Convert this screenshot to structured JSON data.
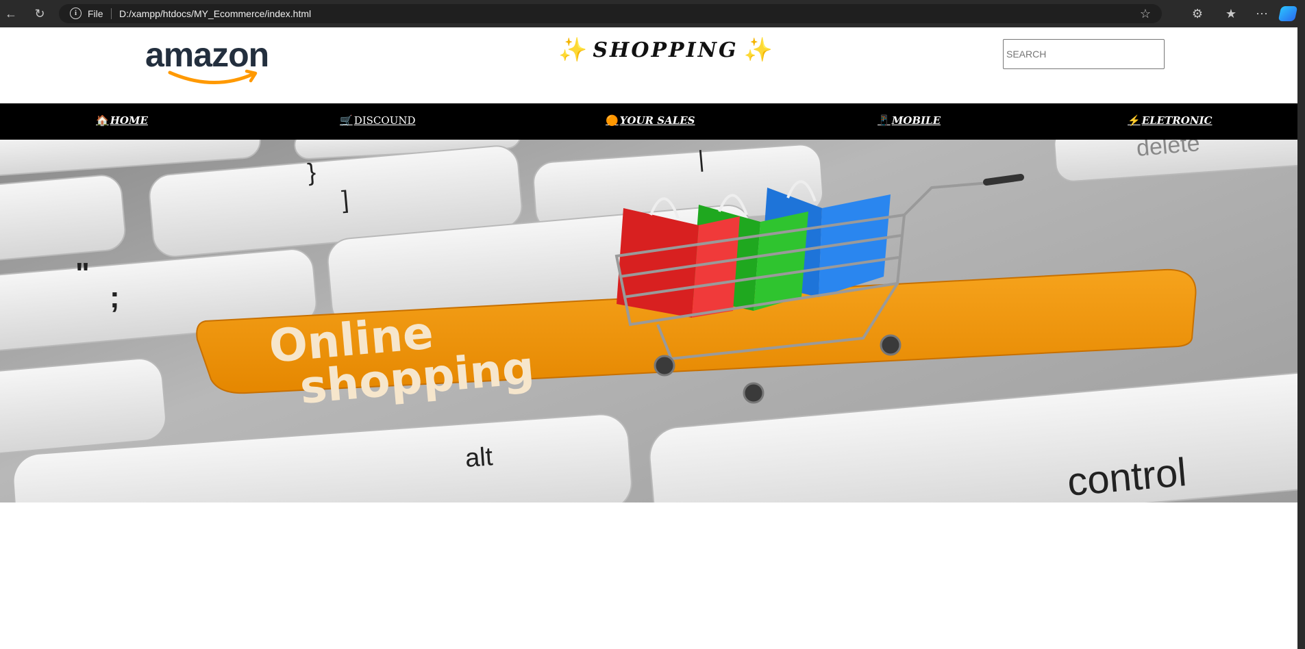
{
  "browser": {
    "scheme_label": "File",
    "url": "D:/xampp/htdocs/MY_Ecommerce/index.html"
  },
  "header": {
    "logo_text": "amazon",
    "title": "SHOPPING",
    "title_sparkle": "✨",
    "search_placeholder": "SEARCH"
  },
  "nav": {
    "items": [
      {
        "icon": "🏠",
        "label": "HOME"
      },
      {
        "icon": "🛒",
        "label": "DISCOUND"
      },
      {
        "icon": "🟠",
        "label": "YOUR SALES"
      },
      {
        "icon": "📱",
        "label": "MOBILE"
      },
      {
        "icon": "⚡",
        "label": "ELETRONIC"
      }
    ]
  },
  "hero": {
    "key_text_line1": "Online",
    "key_text_line2": "shopping",
    "key_alt": "alt",
    "key_control": "control",
    "key_delete": "delete"
  },
  "colors": {
    "navbar_bg": "#000000",
    "hero_key_orange": "#f0920a",
    "logo_smile": "#ff9900",
    "chrome_bg": "#2b2b2b"
  }
}
